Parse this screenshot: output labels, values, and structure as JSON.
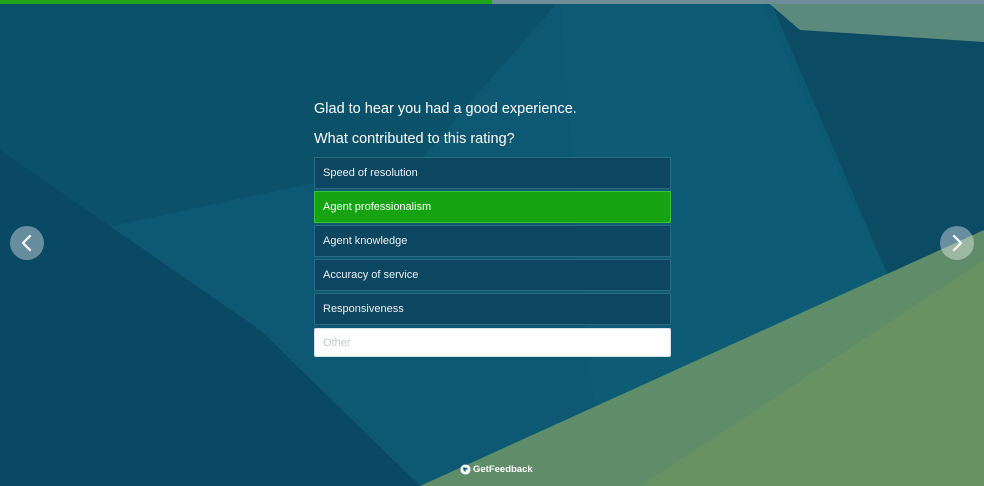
{
  "progress": {
    "fraction": 0.5
  },
  "colors": {
    "accent": "#1fa31b",
    "option_bg": "#0d4660",
    "background": "#0e5a74"
  },
  "survey": {
    "intro": "Glad to hear you had a good experience.",
    "question": "What contributed to this rating?",
    "options": [
      {
        "label": "Speed of resolution",
        "selected": false
      },
      {
        "label": "Agent professionalism",
        "selected": true
      },
      {
        "label": "Agent knowledge",
        "selected": false
      },
      {
        "label": "Accuracy of service",
        "selected": false
      },
      {
        "label": "Responsiveness",
        "selected": false
      }
    ],
    "other_placeholder": "Other"
  },
  "nav": {
    "prev_icon": "chevron-left-icon",
    "next_icon": "chevron-right-icon"
  },
  "footer": {
    "brand": "GetFeedback",
    "logo_icon": "getfeedback-logo-icon"
  }
}
